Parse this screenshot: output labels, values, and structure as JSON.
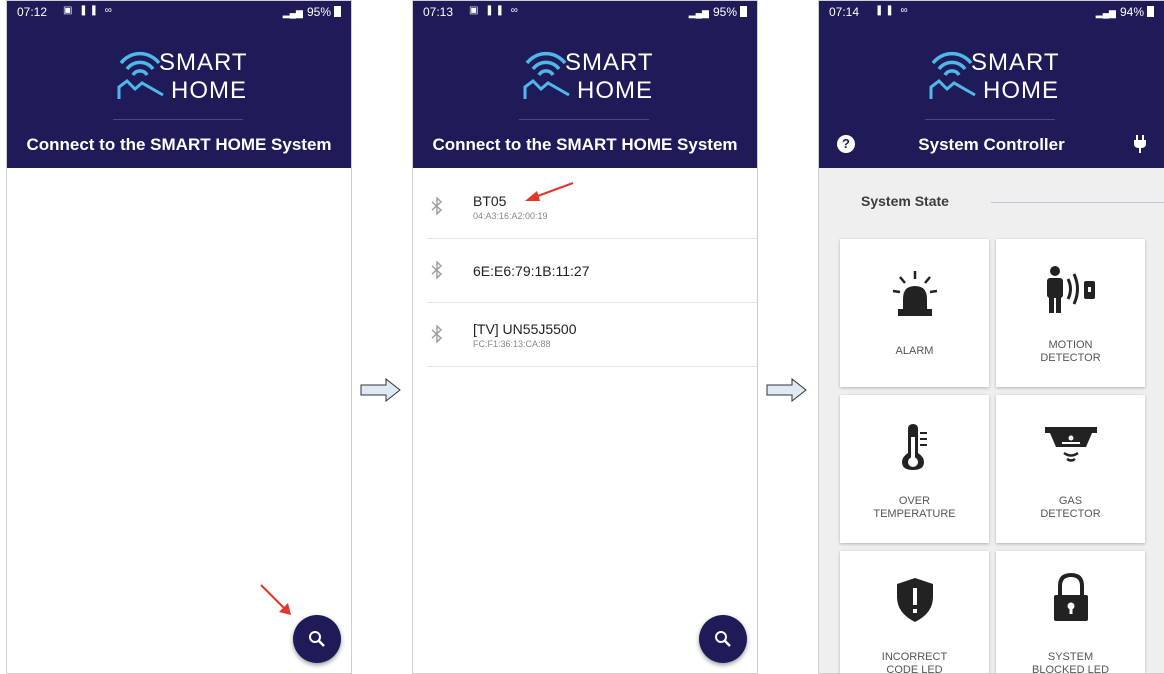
{
  "screens": {
    "scan": {
      "status": {
        "time": "07:12",
        "battery": "95%"
      },
      "logo": {
        "line1": "SMART",
        "line2": "HOME"
      },
      "subtitle": "Connect to the SMART HOME System",
      "fab_icon": "search-icon"
    },
    "devices": {
      "status": {
        "time": "07:13",
        "battery": "95%"
      },
      "logo": {
        "line1": "SMART",
        "line2": "HOME"
      },
      "subtitle": "Connect to the SMART HOME System",
      "list": [
        {
          "name": "BT05",
          "mac": "04:A3:16:A2:00:19"
        },
        {
          "name": "6E:E6:79:1B:11:27",
          "mac": ""
        },
        {
          "name": "[TV] UN55J5500",
          "mac": "FC:F1:36:13:CA:88"
        }
      ],
      "fab_icon": "search-icon"
    },
    "controller": {
      "status": {
        "time": "07:14",
        "battery": "94%"
      },
      "logo": {
        "line1": "SMART",
        "line2": "HOME"
      },
      "title": "System Controller",
      "help_icon": "?",
      "section": "System State",
      "cards": [
        {
          "line1": "ALARM",
          "line2": "",
          "icon": "siren-icon"
        },
        {
          "line1": "MOTION",
          "line2": "DETECTOR",
          "icon": "motion-detector-icon"
        },
        {
          "line1": "OVER",
          "line2": "TEMPERATURE",
          "icon": "thermometer-icon"
        },
        {
          "line1": "GAS",
          "line2": "DETECTOR",
          "icon": "gas-detector-icon"
        },
        {
          "line1": "INCORRECT",
          "line2": "CODE LED",
          "icon": "shield-alert-icon"
        },
        {
          "line1": "SYSTEM",
          "line2": "BLOCKED LED",
          "icon": "padlock-icon"
        }
      ]
    }
  },
  "colors": {
    "header": "#1f1b59",
    "logo_accent": "#4fb8e8",
    "annotation_arrow": "#e2382b"
  }
}
